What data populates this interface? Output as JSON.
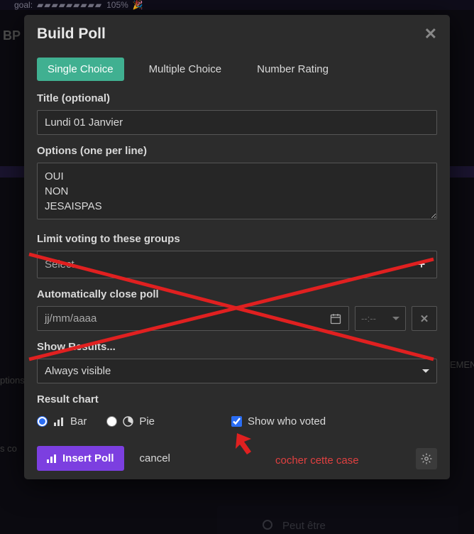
{
  "bg": {
    "goal": "goal:",
    "pct": "105%",
    "bp": "BP",
    "ement": "EMEN",
    "ptions": "ptions",
    "sco": "s co",
    "peut": "Peut être"
  },
  "modal": {
    "title": "Build Poll",
    "tabs": {
      "single": "Single Choice",
      "multiple": "Multiple Choice",
      "number": "Number Rating"
    },
    "labels": {
      "title": "Title (optional)",
      "options": "Options (one per line)",
      "groups": "Limit voting to these groups",
      "autoclose": "Automatically close poll",
      "showresults": "Show Results...",
      "resultchart": "Result chart"
    },
    "values": {
      "title": "Lundi 01 Janvier",
      "options": "OUI\nNON\nJESAISPAS",
      "groups_placeholder": "Select...",
      "date_placeholder": "jj/mm/aaaa",
      "time_placeholder": "--:--",
      "results_visibility": "Always visible"
    },
    "chart": {
      "bar": "Bar",
      "pie": "Pie",
      "whovoted": "Show who voted"
    },
    "footer": {
      "insert": "Insert Poll",
      "cancel": "cancel"
    }
  },
  "annotation": {
    "text": "cocher cette case"
  }
}
